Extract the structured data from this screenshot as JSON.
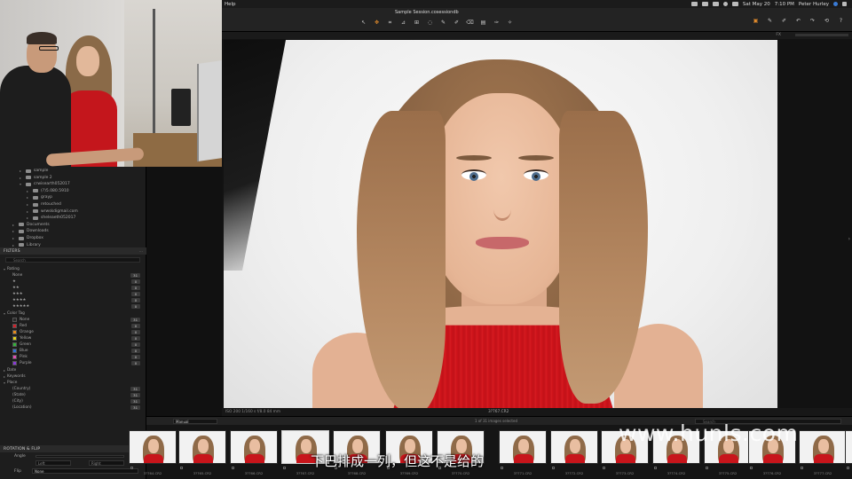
{
  "menubar": {
    "help": "Help",
    "date": "Sat May 20",
    "time": "7:10 PM",
    "user": "Peter Hurley"
  },
  "toolbar": {
    "session_title": "Sample Session.cosessiondb",
    "fx_label": "FX",
    "tools": [
      "select-cursor",
      "pan",
      "crop",
      "straighten",
      "keystone",
      "spot",
      "annotate",
      "brush",
      "eraser",
      "gradient",
      "picker",
      "magic"
    ],
    "right_tools": [
      "copy-adjust",
      "apply",
      "undo",
      "redo",
      "reset",
      "help"
    ]
  },
  "sidebar": {
    "folders": [
      {
        "label": "sample",
        "indent": 2
      },
      {
        "label": "sample 2",
        "indent": 2
      },
      {
        "label": "crwisearth052017",
        "indent": 2,
        "open": true
      },
      {
        "label": "(?)5.080.5910",
        "indent": 3
      },
      {
        "label": "grayp",
        "indent": 3
      },
      {
        "label": "retouched",
        "indent": 3
      },
      {
        "label": "wrwskdigmail.com",
        "indent": 3
      },
      {
        "label": "sheleaeth052017",
        "indent": 3
      },
      {
        "label": "Documents",
        "indent": 1
      },
      {
        "label": "Downloads",
        "indent": 1
      },
      {
        "label": "Dropbox",
        "indent": 1
      },
      {
        "label": "Library",
        "indent": 1
      }
    ],
    "filters_title": "FILTERS",
    "search_placeholder": "Search",
    "rating_title": "Rating",
    "ratings": [
      {
        "label": "None",
        "count": "31"
      },
      {
        "label": "★",
        "count": "0"
      },
      {
        "label": "★★",
        "count": "0"
      },
      {
        "label": "★★★",
        "count": "0"
      },
      {
        "label": "★★★★",
        "count": "0"
      },
      {
        "label": "★★★★★",
        "count": "0"
      }
    ],
    "color_tag_title": "Color Tag",
    "color_tags": [
      {
        "label": "None",
        "color": "#2a2a2a",
        "count": "31"
      },
      {
        "label": "Red",
        "color": "#d0202a",
        "count": "0"
      },
      {
        "label": "Orange",
        "color": "#e58a1c",
        "count": "0"
      },
      {
        "label": "Yellow",
        "color": "#e5d21c",
        "count": "0"
      },
      {
        "label": "Green",
        "color": "#33b33a",
        "count": "0"
      },
      {
        "label": "Blue",
        "color": "#2e6fd6",
        "count": "0"
      },
      {
        "label": "Pink",
        "color": "#de4fb5",
        "count": "0"
      },
      {
        "label": "Purple",
        "color": "#8a3ad6",
        "count": "0"
      }
    ],
    "date_title": "Date",
    "keywords_title": "Keywords",
    "place_title": "Place",
    "places": [
      {
        "label": "(Country)",
        "count": "31"
      },
      {
        "label": "(State)",
        "count": "31"
      },
      {
        "label": "(City)",
        "count": "31"
      },
      {
        "label": "(Location)",
        "count": "31"
      }
    ],
    "rotation_title": "ROTATION & FLIP",
    "angle_label": "Angle",
    "left_label": "Left",
    "right_label": "Right",
    "flip_label": "Flip",
    "flip_value": "None"
  },
  "viewer": {
    "meta": "ISO 200   1/160 s   f/8.0   84 mm",
    "filename": "3?767.CR2"
  },
  "browser": {
    "sort_value": "Manual",
    "count_text": "1 of 31 images selected",
    "search_placeholder": "Search"
  },
  "filmstrip": [
    "3?764.CR2",
    "3?765.CR2",
    "3?766.CR2",
    "3?767.CR2",
    "3?768.CR2",
    "3?769.CR2",
    "3?770.CR2",
    "3?771.CR2",
    "3?772.CR2",
    "3?773.CR2",
    "3?774.CR2",
    "3?775.CR2",
    "3?776.CR2",
    "3?777.CR2",
    "3?778.CR2"
  ],
  "overlay": {
    "watermark": "www.hunls.com",
    "subtitle": "下巴排成一列，但这不是给的"
  }
}
